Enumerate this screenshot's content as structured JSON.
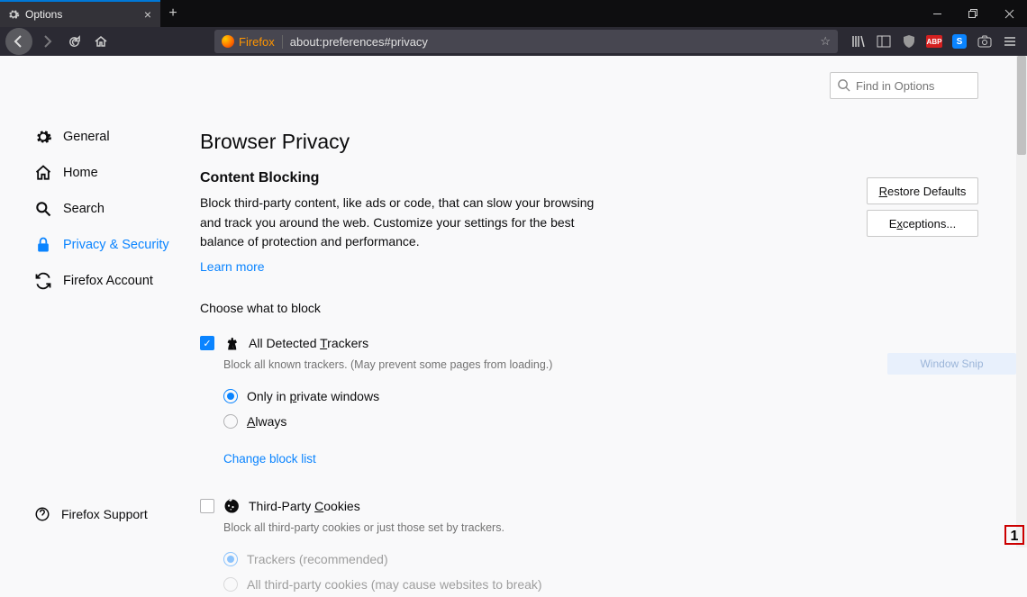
{
  "tab": {
    "title": "Options"
  },
  "url": {
    "chip": "Firefox",
    "path": "about:preferences#privacy"
  },
  "toolbar_icons": {
    "abp": "ABP",
    "s": "S"
  },
  "search": {
    "placeholder": "Find in Options"
  },
  "sidebar": {
    "items": [
      {
        "label": "General"
      },
      {
        "label": "Home"
      },
      {
        "label": "Search"
      },
      {
        "label": "Privacy & Security"
      },
      {
        "label": "Firefox Account"
      }
    ],
    "support": "Firefox Support"
  },
  "page": {
    "title": "Browser Privacy",
    "section": "Content Blocking",
    "desc": "Block third-party content, like ads or code, that can slow your browsing and track you around the web. Customize your settings for the best balance of protection and performance.",
    "learn": "Learn more",
    "choose": "Choose what to block",
    "restore": "Restore Defaults",
    "exceptions": "Exceptions...",
    "trackers": {
      "label": "All Detected Trackers",
      "sub": "Block all known trackers. (May prevent some pages from loading.)",
      "r1": "Only in private windows",
      "r2": "Always",
      "change": "Change block list"
    },
    "cookies": {
      "label": "Third-Party Cookies",
      "sub": "Block all third-party cookies or just those set by trackers.",
      "r1": "Trackers (recommended)",
      "r2": "All third-party cookies (may cause websites to break)"
    }
  },
  "snip": "Window Snip"
}
